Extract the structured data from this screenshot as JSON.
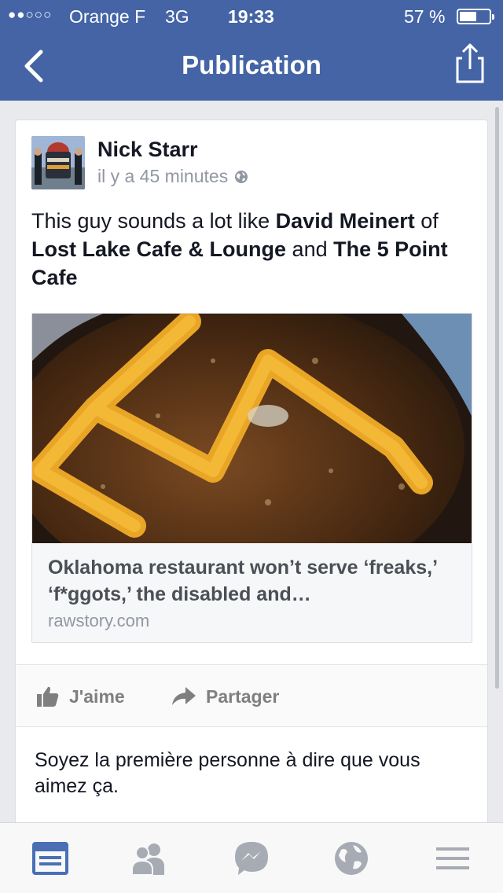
{
  "status_bar": {
    "signal": "●●○○○",
    "carrier": "Orange F",
    "network": "3G",
    "time": "19:33",
    "battery": "57 %",
    "battery_level": 0.57
  },
  "nav": {
    "title": "Publication",
    "back_icon": "chevron-left-icon",
    "share_icon": "share-icon"
  },
  "post": {
    "author": "Nick Starr",
    "timestamp": "il y a 45 minutes",
    "privacy_icon": "globe-icon",
    "text": {
      "part1": "This guy sounds a lot like ",
      "mention1": "David Meinert",
      "part2": " of ",
      "mention2": "Lost Lake Cafe & Lounge",
      "part3": " and ",
      "mention3": "The 5 Point Cafe"
    },
    "link": {
      "title": "Oklahoma restaurant won’t serve ‘freaks,’ ‘f*ggots,’ the disabled and…",
      "domain": "rawstory.com"
    }
  },
  "actions": {
    "like": "J'aime",
    "share": "Partager"
  },
  "likes_summary": "Soyez la première personne à dire que vous aimez ça.",
  "tabs": [
    {
      "name": "news-feed-icon",
      "active": true
    },
    {
      "name": "friends-icon",
      "active": false
    },
    {
      "name": "messenger-icon",
      "active": false
    },
    {
      "name": "notifications-globe-icon",
      "active": false
    },
    {
      "name": "menu-icon",
      "active": false
    }
  ],
  "colors": {
    "brand": "#4464a6",
    "active_tab": "#4a6fb5",
    "inactive_tab": "#a7abb3"
  }
}
